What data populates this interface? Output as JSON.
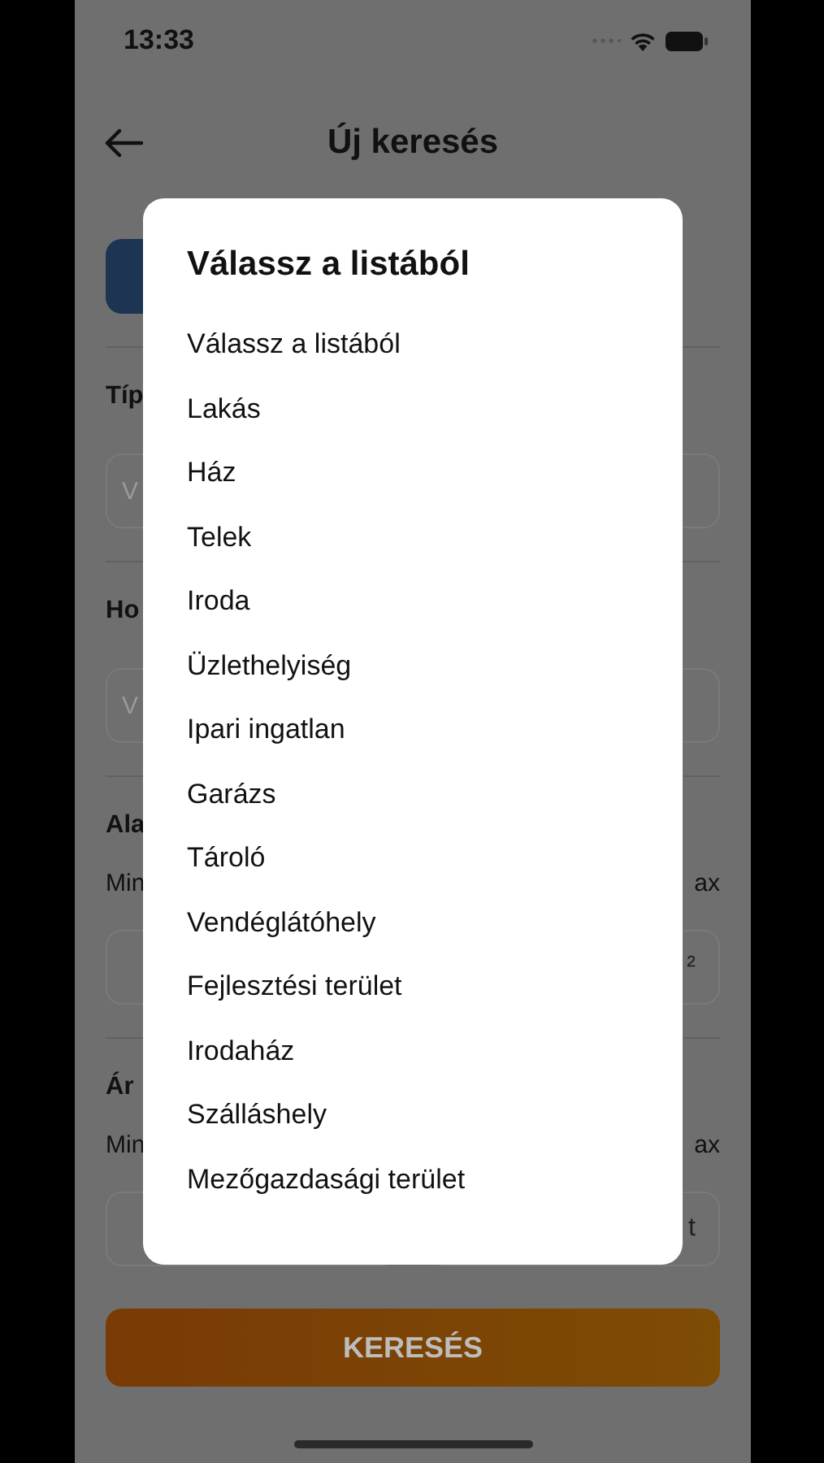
{
  "status_bar": {
    "time": "13:33"
  },
  "header": {
    "title": "Új keresés"
  },
  "form": {
    "sections": [
      {
        "kind": "select",
        "label": "Típ",
        "placeholder": "V"
      },
      {
        "kind": "select",
        "label": "Ho",
        "placeholder": "V"
      },
      {
        "kind": "range",
        "label": "Ala",
        "min_label": "Min",
        "max_label": "ax",
        "unit": "²"
      },
      {
        "kind": "range",
        "label": "Ár",
        "min_label": "Min",
        "max_label": "ax",
        "unit": "t"
      }
    ]
  },
  "search_button": {
    "label": "KERESÉS"
  },
  "picker": {
    "title": "Válassz a listából",
    "options": [
      "Válassz a listából",
      "Lakás",
      "Ház",
      "Telek",
      "Iroda",
      "Üzlethelyiség",
      "Ipari ingatlan",
      "Garázs",
      "Tároló",
      "Vendéglátóhely",
      "Fejlesztési terület",
      "Irodaház",
      "Szálláshely",
      "Mezőgazdasági terület"
    ]
  }
}
